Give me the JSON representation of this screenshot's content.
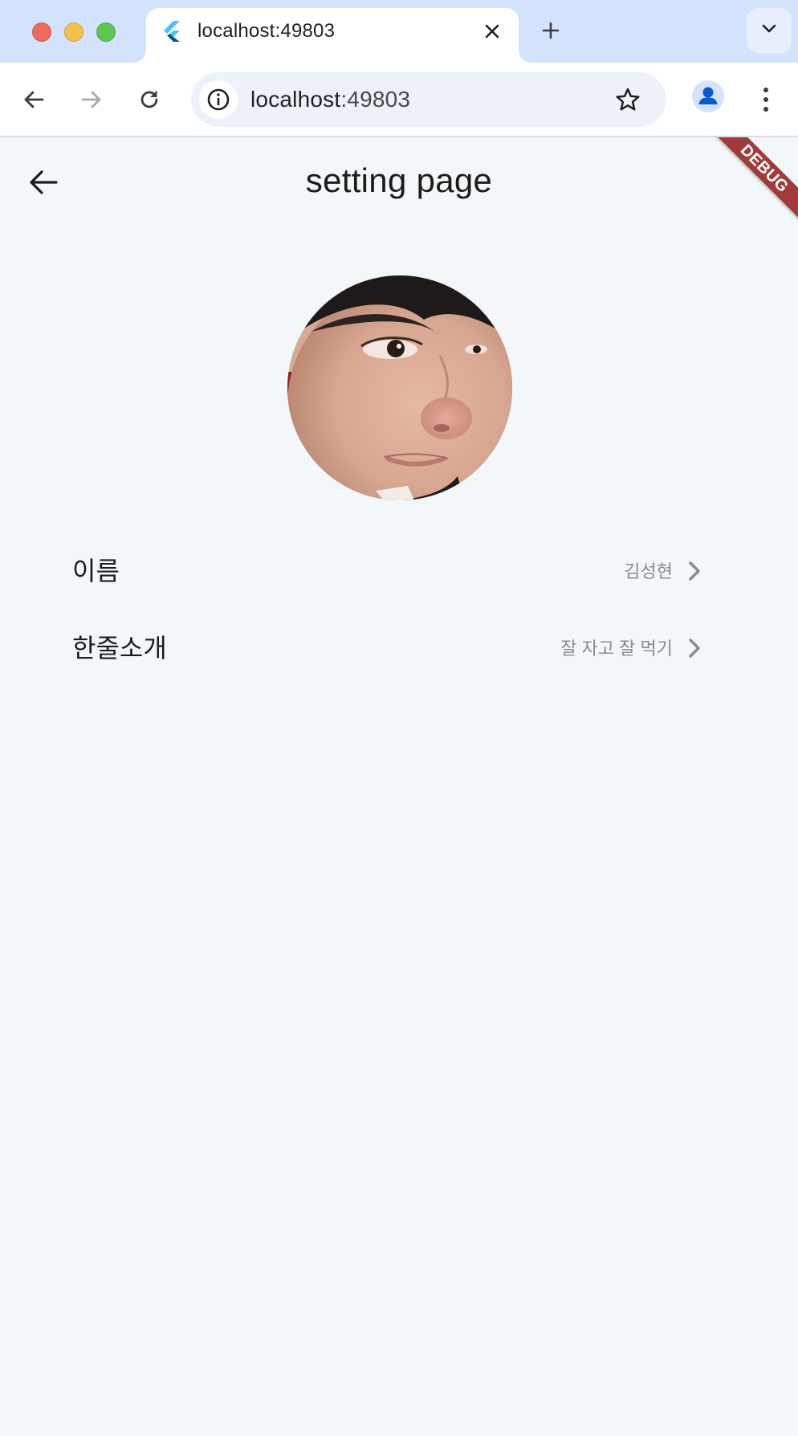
{
  "browser": {
    "tab": {
      "title": "localhost:49803"
    },
    "address_bar": {
      "host": "localhost",
      "port": ":49803"
    }
  },
  "page": {
    "title": "setting page",
    "debug_banner": "DEBUG",
    "settings": [
      {
        "label": "이름",
        "value": "김성현"
      },
      {
        "label": "한줄소개",
        "value": "잘 자고 잘 먹기"
      }
    ]
  },
  "icons": {
    "back": "arrow-left-icon",
    "forward": "arrow-right-icon",
    "reload": "reload-icon",
    "site_info": "info-icon",
    "bookmark": "star-icon",
    "profile": "person-icon",
    "menu": "kebab-menu-icon",
    "tab_close": "close-icon",
    "new_tab": "plus-icon",
    "tab_search": "chevron-down-icon",
    "favicon": "flutter-logo-icon",
    "row_chevron": "chevron-right-icon"
  },
  "colors": {
    "browser_frame": "#d3e3fd",
    "page_background": "#f4f7f9",
    "debug_banner": "#a13a3a",
    "secondary_text": "#8a8a8a"
  }
}
